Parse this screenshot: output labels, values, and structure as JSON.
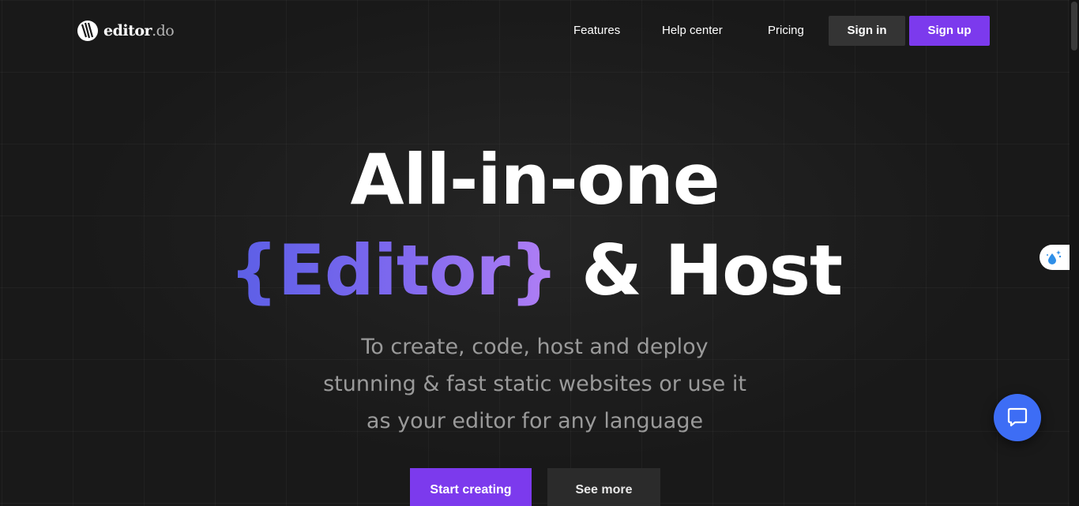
{
  "brand": {
    "name": "editor",
    "tld": ".do"
  },
  "nav": {
    "features": "Features",
    "help_center": "Help center",
    "pricing": "Pricing",
    "sign_in": "Sign in",
    "sign_up": "Sign up"
  },
  "hero": {
    "line1": "All-in-one",
    "line2_highlight": "{Editor}",
    "line2_rest": " & Host",
    "subtitle_lines": [
      "To create, code, host and deploy",
      "stunning & fast static websites or use it",
      "as your editor for any language"
    ],
    "cta_primary": "Start creating",
    "cta_secondary": "See more"
  },
  "icons": {
    "logo": "editor-logo-icon",
    "side_widget": "droplet-sparkle-icon",
    "chat": "chat-bubble-icon"
  },
  "colors": {
    "accent": "#7c3aed",
    "gradient_start": "#5b5fe6",
    "gradient_end": "#b27ff5",
    "chat": "#3d6df5",
    "background": "#191919"
  }
}
